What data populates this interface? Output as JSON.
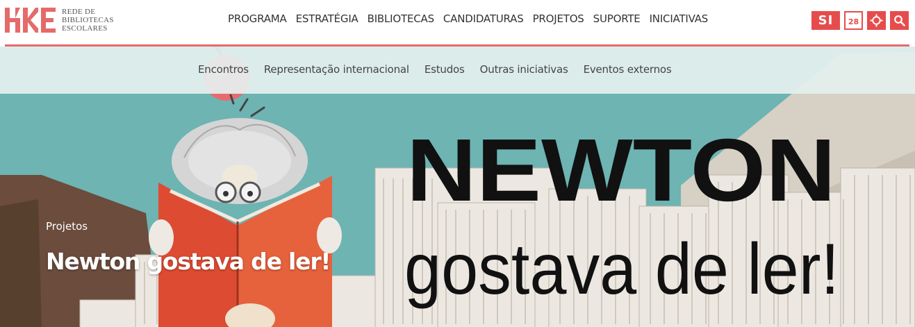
{
  "header": {
    "logo": {
      "lines": [
        "REDE DE",
        "BIBLIOTECAS",
        "ESCOLARES"
      ],
      "mark_icon": "rbe-logo-mark"
    },
    "nav": [
      {
        "label": "PROGRAMA"
      },
      {
        "label": "ESTRATÉGIA"
      },
      {
        "label": "BIBLIOTECAS"
      },
      {
        "label": "CANDIDATURAS"
      },
      {
        "label": "PROJETOS"
      },
      {
        "label": "SUPORTE"
      },
      {
        "label": "INICIATIVAS"
      }
    ],
    "tools": {
      "si_label": "SI",
      "calendar_day": "28",
      "calendar_icon": "calendar-icon",
      "target_icon": "crosshair-icon",
      "search_icon": "search-icon"
    }
  },
  "subnav": [
    {
      "label": "Encontros"
    },
    {
      "label": "Representação internacional"
    },
    {
      "label": "Estudos"
    },
    {
      "label": "Outras iniciativas"
    },
    {
      "label": "Eventos externos"
    }
  ],
  "hero": {
    "eyebrow": "Projetos",
    "title": "Newton gostava de ler!",
    "poster_line1": "NEWTON",
    "poster_line2": "gostava de ler!"
  },
  "colors": {
    "accent": "#e74c4c",
    "rule": "#e56a6a",
    "sky": "#6db4b3",
    "subnav_bg": "#e4f0ee"
  }
}
